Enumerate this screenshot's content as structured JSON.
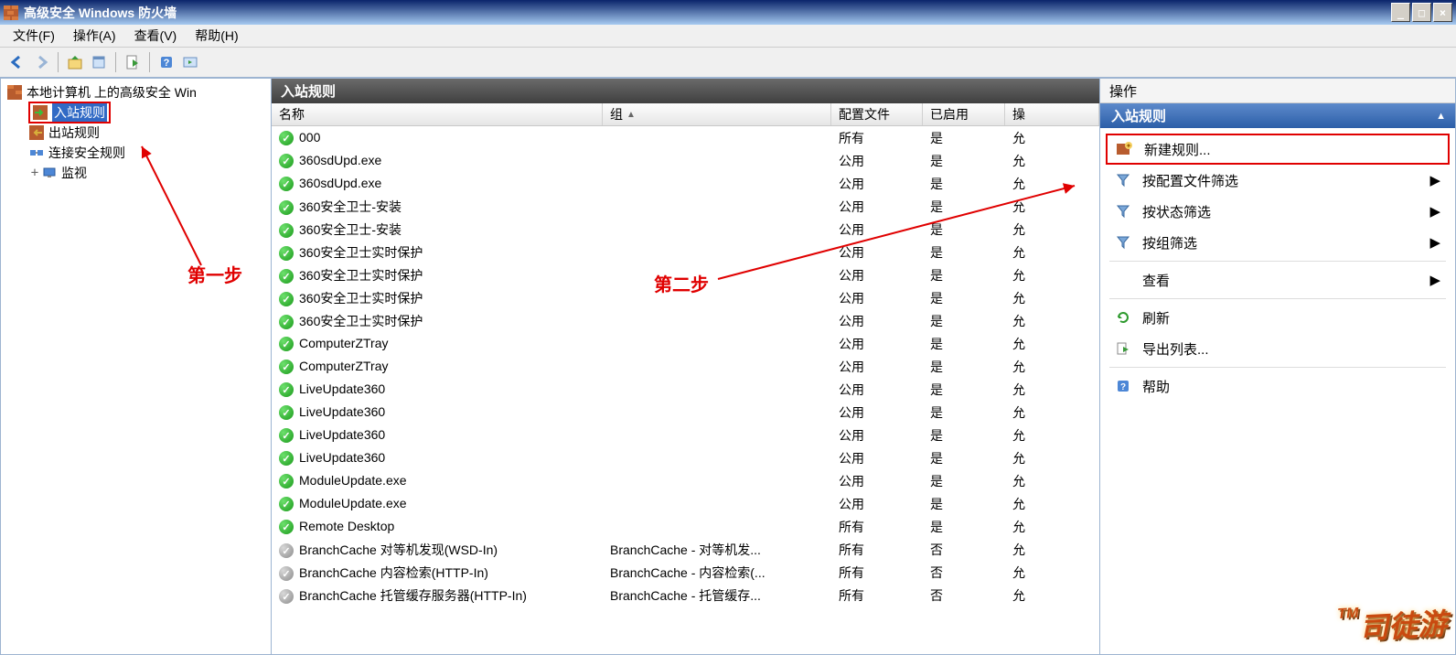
{
  "window": {
    "title": "高级安全 Windows 防火墙"
  },
  "menu": {
    "file": "文件(F)",
    "action": "操作(A)",
    "view": "查看(V)",
    "help": "帮助(H)"
  },
  "tree": {
    "root": "本地计算机 上的高级安全 Win",
    "inbound": "入站规则",
    "outbound": "出站规则",
    "connsec": "连接安全规则",
    "monitor": "监视"
  },
  "center": {
    "title": "入站规则",
    "cols": {
      "name": "名称",
      "group": "组",
      "profile": "配置文件",
      "enabled": "已启用",
      "action": "操"
    },
    "sort_indicator": "▲"
  },
  "rules": [
    {
      "name": "000",
      "group": "",
      "profile": "所有",
      "enabled": "是",
      "action": "允",
      "on": true
    },
    {
      "name": "360sdUpd.exe",
      "group": "",
      "profile": "公用",
      "enabled": "是",
      "action": "允",
      "on": true
    },
    {
      "name": "360sdUpd.exe",
      "group": "",
      "profile": "公用",
      "enabled": "是",
      "action": "允",
      "on": true
    },
    {
      "name": "360安全卫士-安装",
      "group": "",
      "profile": "公用",
      "enabled": "是",
      "action": "允",
      "on": true
    },
    {
      "name": "360安全卫士-安装",
      "group": "",
      "profile": "公用",
      "enabled": "是",
      "action": "允",
      "on": true
    },
    {
      "name": "360安全卫士实时保护",
      "group": "",
      "profile": "公用",
      "enabled": "是",
      "action": "允",
      "on": true
    },
    {
      "name": "360安全卫士实时保护",
      "group": "",
      "profile": "公用",
      "enabled": "是",
      "action": "允",
      "on": true
    },
    {
      "name": "360安全卫士实时保护",
      "group": "",
      "profile": "公用",
      "enabled": "是",
      "action": "允",
      "on": true
    },
    {
      "name": "360安全卫士实时保护",
      "group": "",
      "profile": "公用",
      "enabled": "是",
      "action": "允",
      "on": true
    },
    {
      "name": "ComputerZTray",
      "group": "",
      "profile": "公用",
      "enabled": "是",
      "action": "允",
      "on": true
    },
    {
      "name": "ComputerZTray",
      "group": "",
      "profile": "公用",
      "enabled": "是",
      "action": "允",
      "on": true
    },
    {
      "name": "LiveUpdate360",
      "group": "",
      "profile": "公用",
      "enabled": "是",
      "action": "允",
      "on": true
    },
    {
      "name": "LiveUpdate360",
      "group": "",
      "profile": "公用",
      "enabled": "是",
      "action": "允",
      "on": true
    },
    {
      "name": "LiveUpdate360",
      "group": "",
      "profile": "公用",
      "enabled": "是",
      "action": "允",
      "on": true
    },
    {
      "name": "LiveUpdate360",
      "group": "",
      "profile": "公用",
      "enabled": "是",
      "action": "允",
      "on": true
    },
    {
      "name": "ModuleUpdate.exe",
      "group": "",
      "profile": "公用",
      "enabled": "是",
      "action": "允",
      "on": true
    },
    {
      "name": "ModuleUpdate.exe",
      "group": "",
      "profile": "公用",
      "enabled": "是",
      "action": "允",
      "on": true
    },
    {
      "name": "Remote Desktop",
      "group": "",
      "profile": "所有",
      "enabled": "是",
      "action": "允",
      "on": true
    },
    {
      "name": "BranchCache 对等机发现(WSD-In)",
      "group": "BranchCache - 对等机发...",
      "profile": "所有",
      "enabled": "否",
      "action": "允",
      "on": false
    },
    {
      "name": "BranchCache 内容检索(HTTP-In)",
      "group": "BranchCache - 内容检索(...",
      "profile": "所有",
      "enabled": "否",
      "action": "允",
      "on": false
    },
    {
      "name": "BranchCache 托管缓存服务器(HTTP-In)",
      "group": "BranchCache - 托管缓存...",
      "profile": "所有",
      "enabled": "否",
      "action": "允",
      "on": false
    }
  ],
  "actions": {
    "panel_title": "操作",
    "band": "入站规则",
    "new_rule": "新建规则...",
    "filter_profile": "按配置文件筛选",
    "filter_state": "按状态筛选",
    "filter_group": "按组筛选",
    "view": "查看",
    "refresh": "刷新",
    "export": "导出列表...",
    "help": "帮助"
  },
  "annotations": {
    "step1": "第一步",
    "step2": "第二步"
  },
  "watermark": {
    "tm": "TM",
    "text": "司徒游"
  }
}
